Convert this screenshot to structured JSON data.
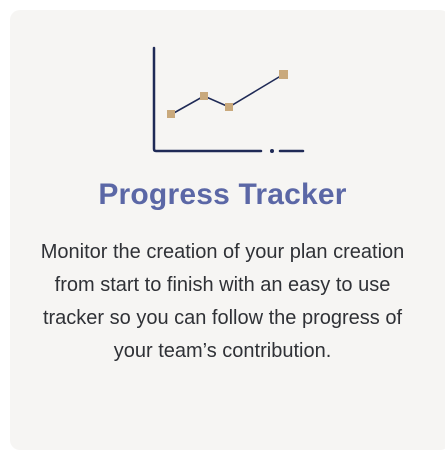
{
  "card": {
    "icon": "line-chart-icon",
    "title": "Progress Tracker",
    "description": "Monitor the creation of your plan creation from start to finish with an easy to use tracker so you can follow the progress of your team’s contribution."
  },
  "colors": {
    "title": "#5b67a6",
    "text": "#2f3136",
    "icon_line": "#1f2a56",
    "icon_marker": "#c9a97c",
    "card_bg": "#f6f5f3"
  }
}
